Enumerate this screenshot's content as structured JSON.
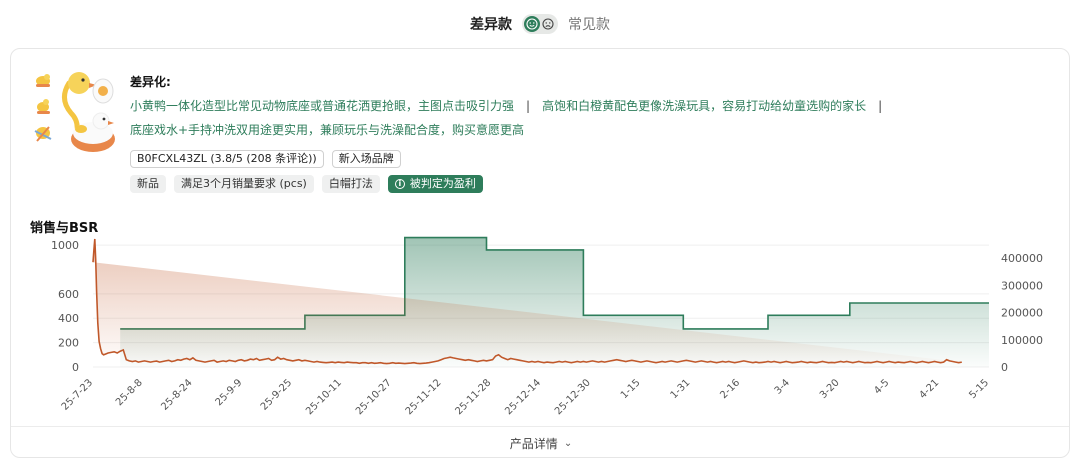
{
  "toggle": {
    "left_label": "差异款",
    "right_label": "常见款",
    "active": "left"
  },
  "product": {
    "diff_title": "差异化:",
    "diff_points": [
      "小黄鸭一体化造型比常见动物底座或普通花洒更抢眼，主图点击吸引力强",
      "高饱和白橙黄配色更像洗澡玩具，容易打动给幼童选购的家长",
      "底座戏水+手持冲洗双用途更实用，兼顾玩乐与洗澡配合度，购买意愿更高"
    ],
    "separator": "|",
    "chips_row1": [
      "B0FCXL43ZL (3.8/5 (208 条评论))",
      "新入场品牌"
    ],
    "chips_row2": [
      "新品",
      "满足3个月销量要求 (pcs)",
      "白帽打法"
    ],
    "verdict_chip": "被判定为盈利"
  },
  "chart_section_title": "销售与BSR",
  "chart_data": {
    "type": "line",
    "x_tick_labels": [
      "25-7-23",
      "25-8-8",
      "25-8-24",
      "25-9-9",
      "25-9-25",
      "25-10-11",
      "25-10-27",
      "25-11-12",
      "25-11-28",
      "25-12-14",
      "25-12-30",
      "1-15",
      "1-31",
      "2-16",
      "3-4",
      "3-20",
      "4-5",
      "4-21",
      "5-15"
    ],
    "y_left_ticks": [
      0,
      200,
      400,
      600,
      1000
    ],
    "y_left_range": [
      0,
      1050
    ],
    "y_right_ticks": [
      0,
      100000,
      200000,
      300000,
      400000
    ],
    "y_right_range": [
      0,
      470000
    ],
    "colors": {
      "sales": "#c0582a",
      "bsr": "#2e7d5b"
    },
    "series": [
      {
        "axis": "left",
        "t": [
          0,
          0.3,
          0.6,
          0.9,
          1.2,
          1.6,
          2,
          2.5,
          3,
          3.5,
          4,
          5,
          6,
          7,
          8,
          9,
          10,
          11,
          12,
          13,
          14,
          15,
          16,
          17,
          18,
          19,
          20,
          21,
          22,
          23,
          24,
          25,
          26,
          27,
          28,
          29,
          30,
          31,
          32,
          33,
          34,
          35,
          36,
          37,
          38,
          39,
          40,
          41,
          42,
          43,
          44,
          45,
          46,
          47,
          48,
          49,
          50,
          51,
          52,
          53,
          54,
          55,
          56,
          57,
          58,
          59,
          60,
          61,
          62,
          63,
          64,
          65,
          66,
          67,
          68,
          69,
          70,
          71,
          72,
          73,
          74,
          75,
          76,
          77,
          78,
          79,
          80,
          81,
          82,
          83,
          84,
          85,
          86,
          87,
          88,
          89,
          90,
          91,
          92,
          93,
          94,
          95,
          96,
          97,
          98,
          99,
          100,
          101,
          102,
          103,
          104,
          105,
          106,
          107,
          108,
          109,
          110,
          111,
          112,
          113,
          114,
          115,
          116,
          117,
          118,
          119,
          120,
          121,
          122,
          123,
          124,
          125,
          126,
          127,
          128,
          129,
          130,
          131,
          132,
          133,
          134,
          135,
          136,
          137,
          138,
          139,
          140,
          141,
          142,
          143,
          144,
          145,
          146,
          147,
          148,
          149,
          150,
          151,
          152,
          153,
          154,
          155,
          156,
          157,
          158,
          159,
          160,
          161,
          162,
          163,
          164,
          165,
          166,
          167,
          168,
          169,
          170,
          171,
          172,
          173,
          174,
          175,
          176,
          177,
          178,
          179,
          180,
          181,
          182,
          183,
          184,
          185,
          186,
          187,
          188,
          189,
          190,
          191,
          192,
          193,
          194,
          195,
          196,
          197,
          198,
          199,
          200,
          201,
          202,
          203,
          204,
          205,
          206,
          207,
          208,
          209,
          210,
          211,
          212,
          213,
          214,
          215,
          216,
          217,
          218,
          219,
          220,
          221,
          222,
          223,
          224,
          225,
          226,
          227,
          228,
          229,
          230,
          231,
          232,
          233,
          234,
          235,
          236,
          237,
          238,
          239,
          240,
          241,
          242,
          243,
          244,
          245,
          246,
          247,
          248,
          249,
          250,
          251,
          252,
          253,
          254,
          255,
          256,
          257,
          258,
          259,
          260,
          261,
          262,
          263,
          264,
          265,
          266,
          267,
          268,
          269,
          270,
          271,
          272,
          273,
          274,
          275,
          276,
          277,
          278,
          279,
          280,
          281,
          282,
          283,
          284,
          285,
          286,
          287,
          288,
          289,
          290,
          291,
          292,
          293,
          294,
          295,
          296
        ],
        "values": [
          860,
          960,
          1050,
          880,
          620,
          360,
          210,
          150,
          110,
          100,
          105,
          115,
          120,
          125,
          115,
          130,
          140,
          60,
          50,
          45,
          50,
          40,
          45,
          50,
          45,
          40,
          45,
          48,
          40,
          45,
          50,
          55,
          45,
          50,
          60,
          55,
          65,
          70,
          60,
          75,
          55,
          50,
          45,
          40,
          45,
          50,
          55,
          40,
          45,
          50,
          45,
          55,
          50,
          45,
          55,
          60,
          50,
          55,
          65,
          60,
          70,
          55,
          60,
          65,
          70,
          55,
          60,
          80,
          65,
          70,
          60,
          55,
          50,
          55,
          60,
          50,
          55,
          50,
          45,
          40,
          45,
          40,
          38,
          35,
          38,
          40,
          35,
          40,
          38,
          35,
          40,
          38,
          35,
          35,
          30,
          35,
          35,
          30,
          35,
          30,
          32,
          35,
          30,
          28,
          30,
          35,
          30,
          32,
          30,
          28,
          30,
          32,
          35,
          30,
          28,
          30,
          32,
          35,
          40,
          45,
          50,
          60,
          70,
          75,
          80,
          75,
          70,
          65,
          60,
          55,
          60,
          55,
          50,
          45,
          50,
          55,
          50,
          55,
          60,
          90,
          100,
          80,
          70,
          60,
          70,
          65,
          60,
          55,
          50,
          45,
          40,
          45,
          40,
          45,
          40,
          35,
          40,
          38,
          35,
          40,
          45,
          40,
          45,
          40,
          35,
          40,
          45,
          40,
          45,
          40,
          45,
          50,
          45,
          40,
          45,
          40,
          45,
          50,
          55,
          60,
          55,
          50,
          45,
          50,
          55,
          50,
          45,
          40,
          45,
          50,
          45,
          40,
          35,
          40,
          45,
          40,
          45,
          50,
          45,
          40,
          45,
          50,
          55,
          50,
          45,
          40,
          45,
          50,
          45,
          40,
          45,
          40,
          35,
          40,
          45,
          40,
          45,
          40,
          35,
          40,
          45,
          50,
          45,
          40,
          35,
          40,
          35,
          38,
          40,
          45,
          40,
          45,
          40,
          35,
          40,
          45,
          40,
          35,
          38,
          40,
          45,
          40,
          35,
          40,
          38,
          35,
          40,
          45,
          40,
          35,
          38,
          35,
          40,
          45,
          40,
          45,
          40,
          35,
          40,
          45,
          40,
          35,
          38,
          35,
          40,
          45,
          40,
          35,
          40,
          45,
          40,
          35,
          40,
          38,
          35,
          40,
          45,
          40,
          35,
          40,
          45,
          40,
          35,
          40,
          45,
          40,
          35,
          40,
          60,
          50,
          45,
          40,
          35,
          40
        ]
      },
      {
        "axis": "right",
        "t": [
          9,
          70,
          70,
          103,
          103,
          130,
          130,
          162,
          162,
          195,
          195,
          223,
          223,
          250,
          250,
          281,
          281,
          296
        ],
        "values": [
          140000,
          140000,
          190000,
          190000,
          475000,
          475000,
          430000,
          430000,
          190000,
          190000,
          140000,
          140000,
          190000,
          190000,
          235000,
          235000,
          235000,
          235000
        ]
      }
    ],
    "t_end": 296
  },
  "details_button": "产品详情"
}
